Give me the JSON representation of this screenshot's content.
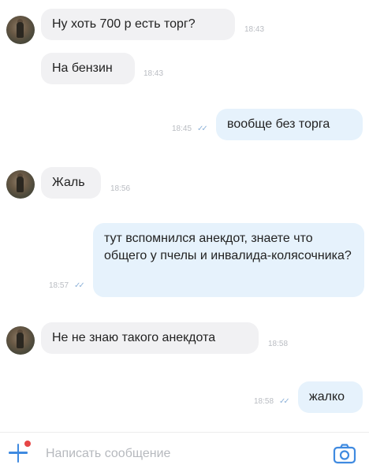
{
  "messages": [
    {
      "direction": "in",
      "text": "Ну хоть 700 р есть торг?",
      "time": "18:43"
    },
    {
      "direction": "in",
      "text": "На бензин",
      "time": "18:43"
    },
    {
      "direction": "out",
      "text": "вообще без торга",
      "time": "18:45"
    },
    {
      "direction": "in",
      "text": "Жаль",
      "time": "18:56"
    },
    {
      "direction": "out",
      "text": "тут вспомнился анекдот, знаете что общего у пчелы и инвалида-колясочника?",
      "time": "18:57"
    },
    {
      "direction": "in",
      "text": "Не не знаю такого анекдота",
      "time": "18:58"
    },
    {
      "direction": "out",
      "text": "жалко",
      "time": "18:58"
    }
  ],
  "composer": {
    "placeholder": "Написать сообщение"
  },
  "icons": {
    "read_checks": "double-check-icon",
    "attach": "plus-icon",
    "camera": "camera-icon"
  },
  "colors": {
    "accent": "#3f8ae0",
    "incoming_bubble": "#f1f1f3",
    "outgoing_bubble": "#e6f2fc",
    "notification_dot": "#e64646"
  }
}
